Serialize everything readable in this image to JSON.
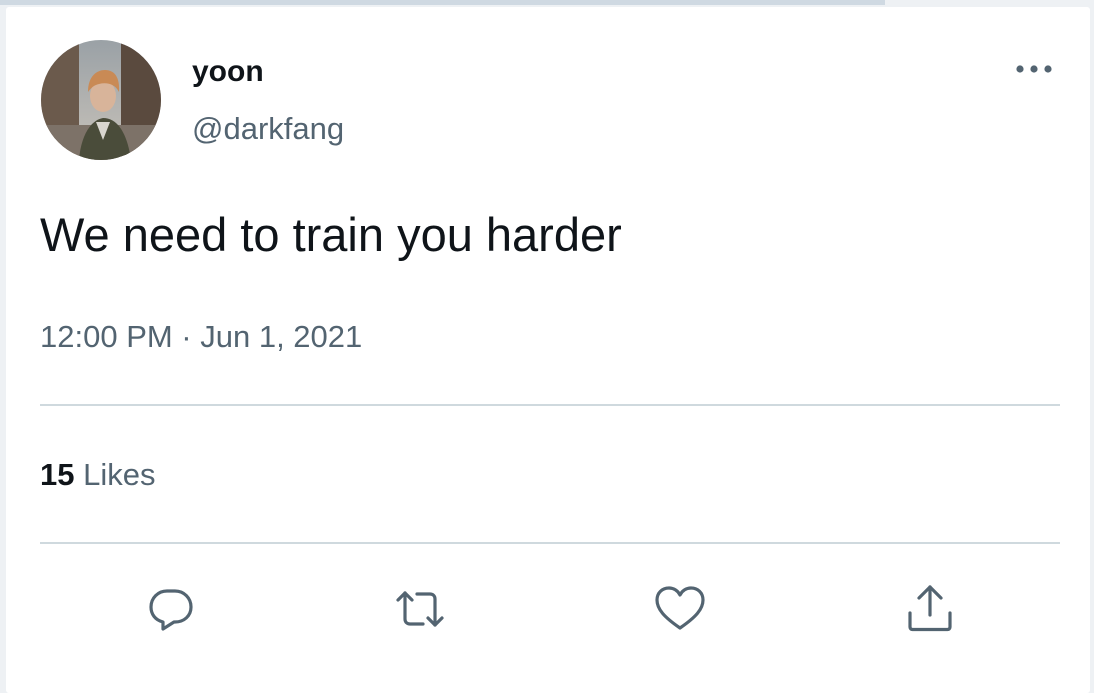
{
  "tweet": {
    "author": {
      "display_name": "yoon",
      "handle": "@darkfang"
    },
    "text": "We need to train you harder",
    "timestamp": "12:00 PM · Jun 1, 2021",
    "likes": {
      "count": "15",
      "label": "Likes"
    }
  },
  "icons": {
    "more": "more-horizontal-icon",
    "reply": "reply-icon",
    "retweet": "retweet-icon",
    "like": "heart-icon",
    "share": "share-icon"
  },
  "colors": {
    "primary_text": "#0f1419",
    "secondary_text": "#536471",
    "divider": "#cfd9de",
    "background": "#ffffff"
  }
}
